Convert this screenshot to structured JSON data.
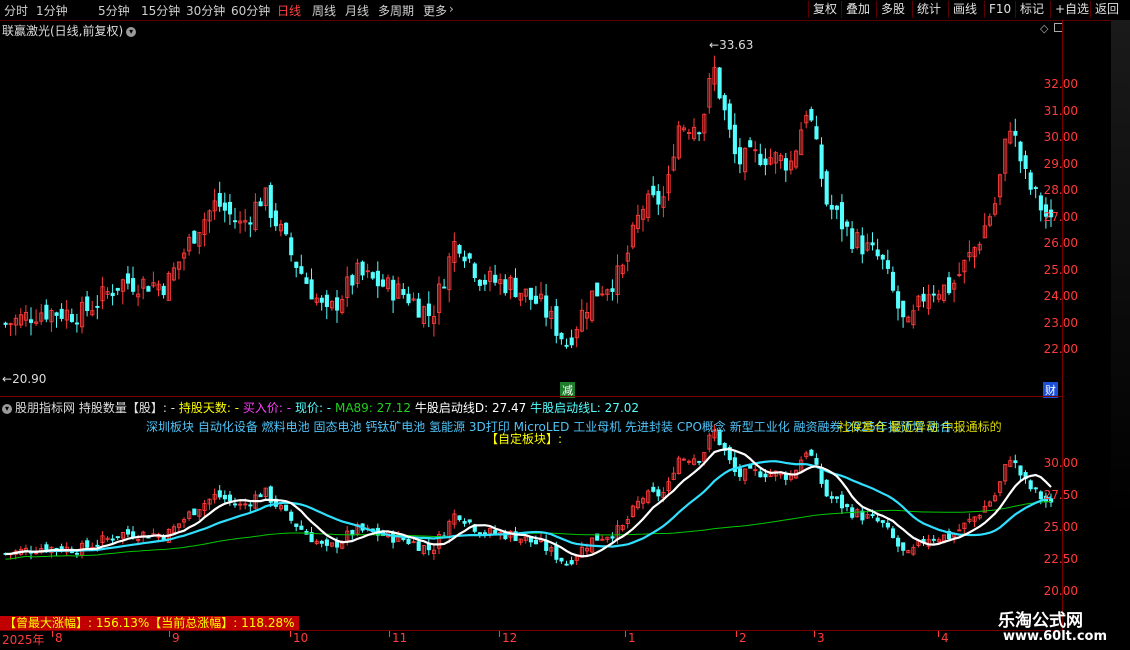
{
  "periods": [
    "分时",
    "1分钟",
    "5分钟",
    "15分钟",
    "30分钟",
    "60分钟",
    "日线",
    "周线",
    "月线",
    "多周期",
    "更多"
  ],
  "active_period": "日线",
  "more_chevron": "chevron-right",
  "right_buttons": [
    "复权",
    "叠加",
    "多股",
    "统计",
    "画线",
    "F10",
    "标记",
    "+自选",
    "返回"
  ],
  "pane1": {
    "title": "联赢激光(日线,前复权)",
    "high_label": "33.63",
    "low_label": "20.90",
    "y_ticks": [
      "32.00",
      "31.00",
      "30.00",
      "29.00",
      "28.00",
      "27.00",
      "26.00",
      "25.00",
      "24.00",
      "23.00",
      "22.00"
    ],
    "badge_jian": "减",
    "badge_cai": "财"
  },
  "pane2": {
    "source": "股朋指标网",
    "hold_qty": "持股数量【股】: -",
    "hold_days": "持股天数: -",
    "buy_price": "买入价: -",
    "now_price": "现价: -",
    "ma89": "MA89: 27.12",
    "bull_d": "牛股启动线D: 27.47",
    "bull_l": "牛股启动线L: 27.02",
    "concepts": "深圳板块 自动化设备 燃料电池 固态电池 钙钛矿电池 氢能源 3D打印 MicroLED 工业母机 先进封装 CPO概念 新型工业化 融资融券 2025年报预增 融合...",
    "overlay": "社保重仓 最近异动 中报通标的",
    "custom_block": "【自定板块】:",
    "y_ticks": [
      "30.00",
      "27.50",
      "25.00",
      "22.50",
      "20.00"
    ]
  },
  "summary": "【曾最大涨幅】: 156.13%【当前总涨幅】: 118.28%",
  "x_axis": {
    "year": "2025年",
    "months": [
      "8",
      "9",
      "10",
      "11",
      "12",
      "1",
      "2",
      "3",
      "4"
    ]
  },
  "watermark": {
    "line1": "乐淘公式网",
    "line2": "www.60lt.com"
  },
  "colors": {
    "up": "#ff3b3b",
    "down": "#54ffff",
    "ma_white": "#ffffff",
    "ma_cyan": "#2fe0ff",
    "ma_green": "#00c800"
  }
}
